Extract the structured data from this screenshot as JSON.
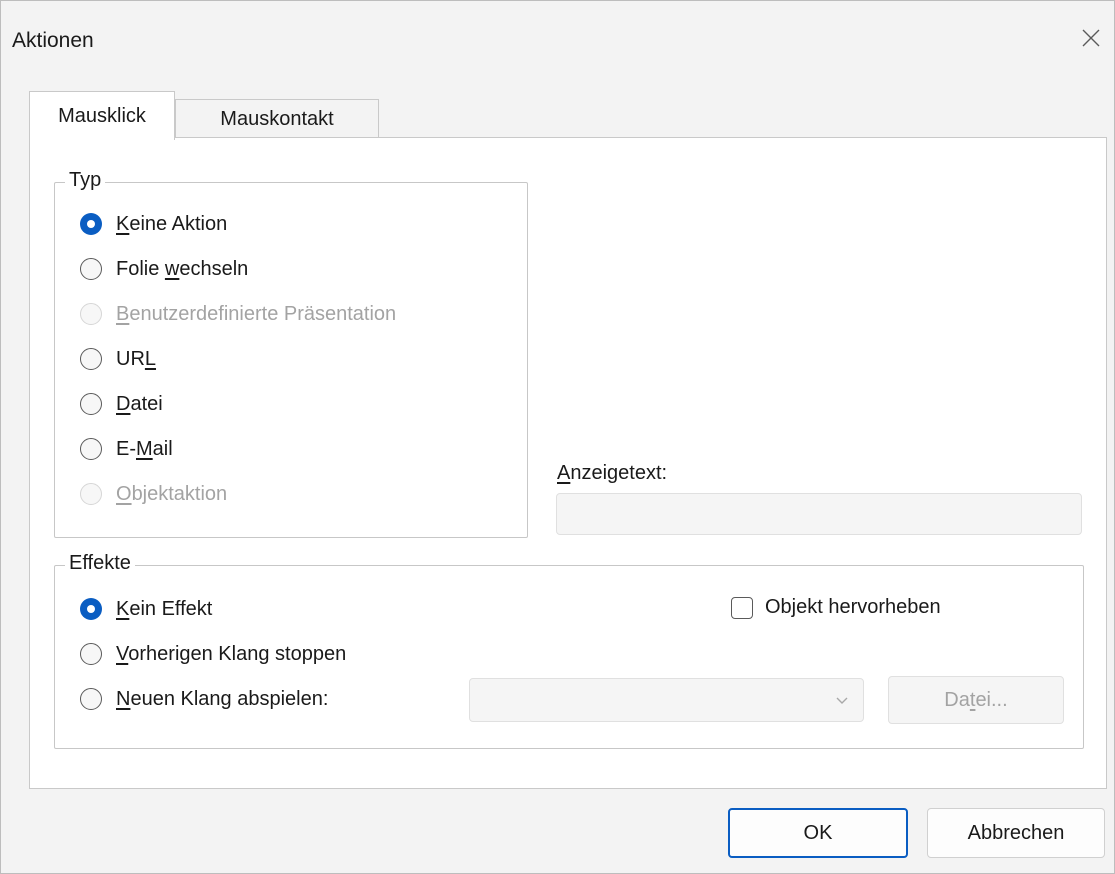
{
  "window": {
    "title": "Aktionen"
  },
  "tabs": [
    {
      "label": "Mausklick",
      "active": true
    },
    {
      "label": "Mauskontakt",
      "active": false
    }
  ],
  "type_group": {
    "label": "Typ",
    "options": [
      {
        "pre": "",
        "key": "K",
        "post": "eine Aktion",
        "checked": true,
        "disabled": false
      },
      {
        "pre": "Folie ",
        "key": "w",
        "post": "echseln",
        "checked": false,
        "disabled": false
      },
      {
        "pre": "",
        "key": "B",
        "post": "enutzerdefinierte Präsentation",
        "checked": false,
        "disabled": true
      },
      {
        "pre": "UR",
        "key": "L",
        "post": "",
        "checked": false,
        "disabled": false
      },
      {
        "pre": "",
        "key": "D",
        "post": "atei",
        "checked": false,
        "disabled": false
      },
      {
        "pre": "E-",
        "key": "M",
        "post": "ail",
        "checked": false,
        "disabled": false
      },
      {
        "pre": "",
        "key": "O",
        "post": "bjektaktion",
        "checked": false,
        "disabled": true
      }
    ]
  },
  "display_text": {
    "pre": "",
    "key": "A",
    "post": "nzeigetext:",
    "value": ""
  },
  "effects_group": {
    "label": "Effekte",
    "options": [
      {
        "pre": "",
        "key": "K",
        "post": "ein Effekt",
        "checked": true
      },
      {
        "pre": "",
        "key": "V",
        "post": "orherigen Klang stoppen",
        "checked": false
      },
      {
        "pre": "",
        "key": "N",
        "post": "euen Klang abspielen:",
        "checked": false
      }
    ],
    "highlight": {
      "label": "Objekt hervorheben",
      "checked": false
    },
    "sound_select": {
      "value": ""
    },
    "file_button": {
      "pre": "Da",
      "key": "t",
      "post": "ei..."
    }
  },
  "buttons": {
    "ok": "OK",
    "cancel": "Abbrechen"
  }
}
